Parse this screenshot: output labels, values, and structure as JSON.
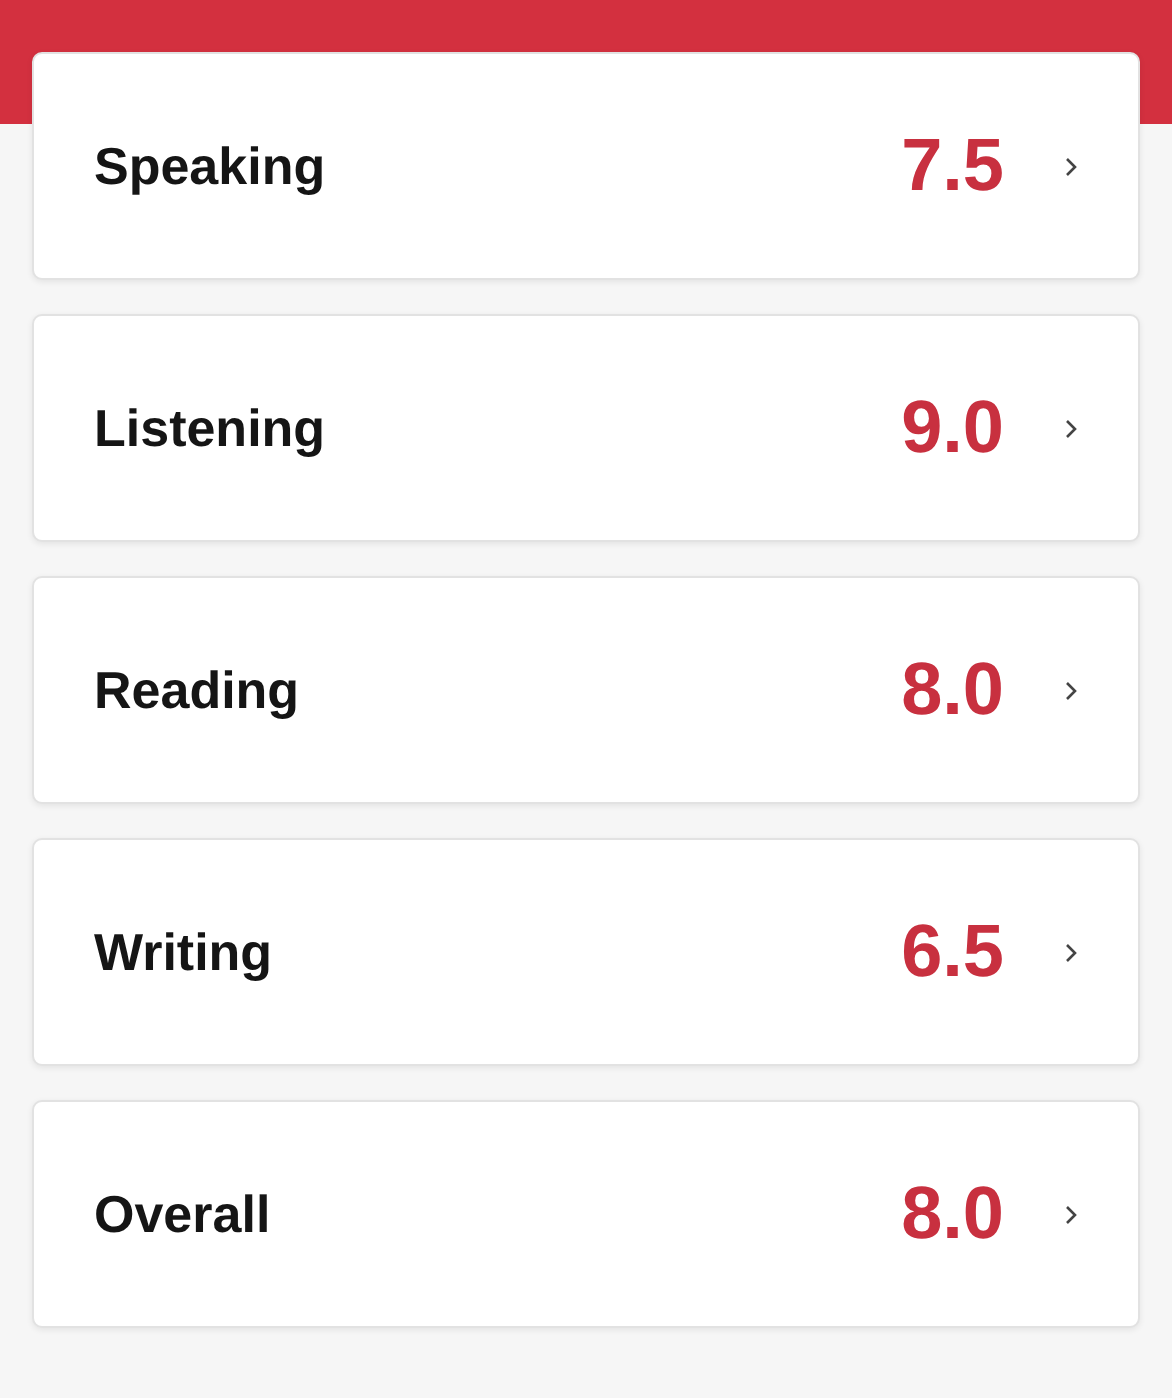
{
  "scores": [
    {
      "label": "Speaking",
      "score": "7.5"
    },
    {
      "label": "Listening",
      "score": "9.0"
    },
    {
      "label": "Reading",
      "score": "8.0"
    },
    {
      "label": "Writing",
      "score": "6.5"
    },
    {
      "label": "Overall",
      "score": "8.0"
    }
  ]
}
